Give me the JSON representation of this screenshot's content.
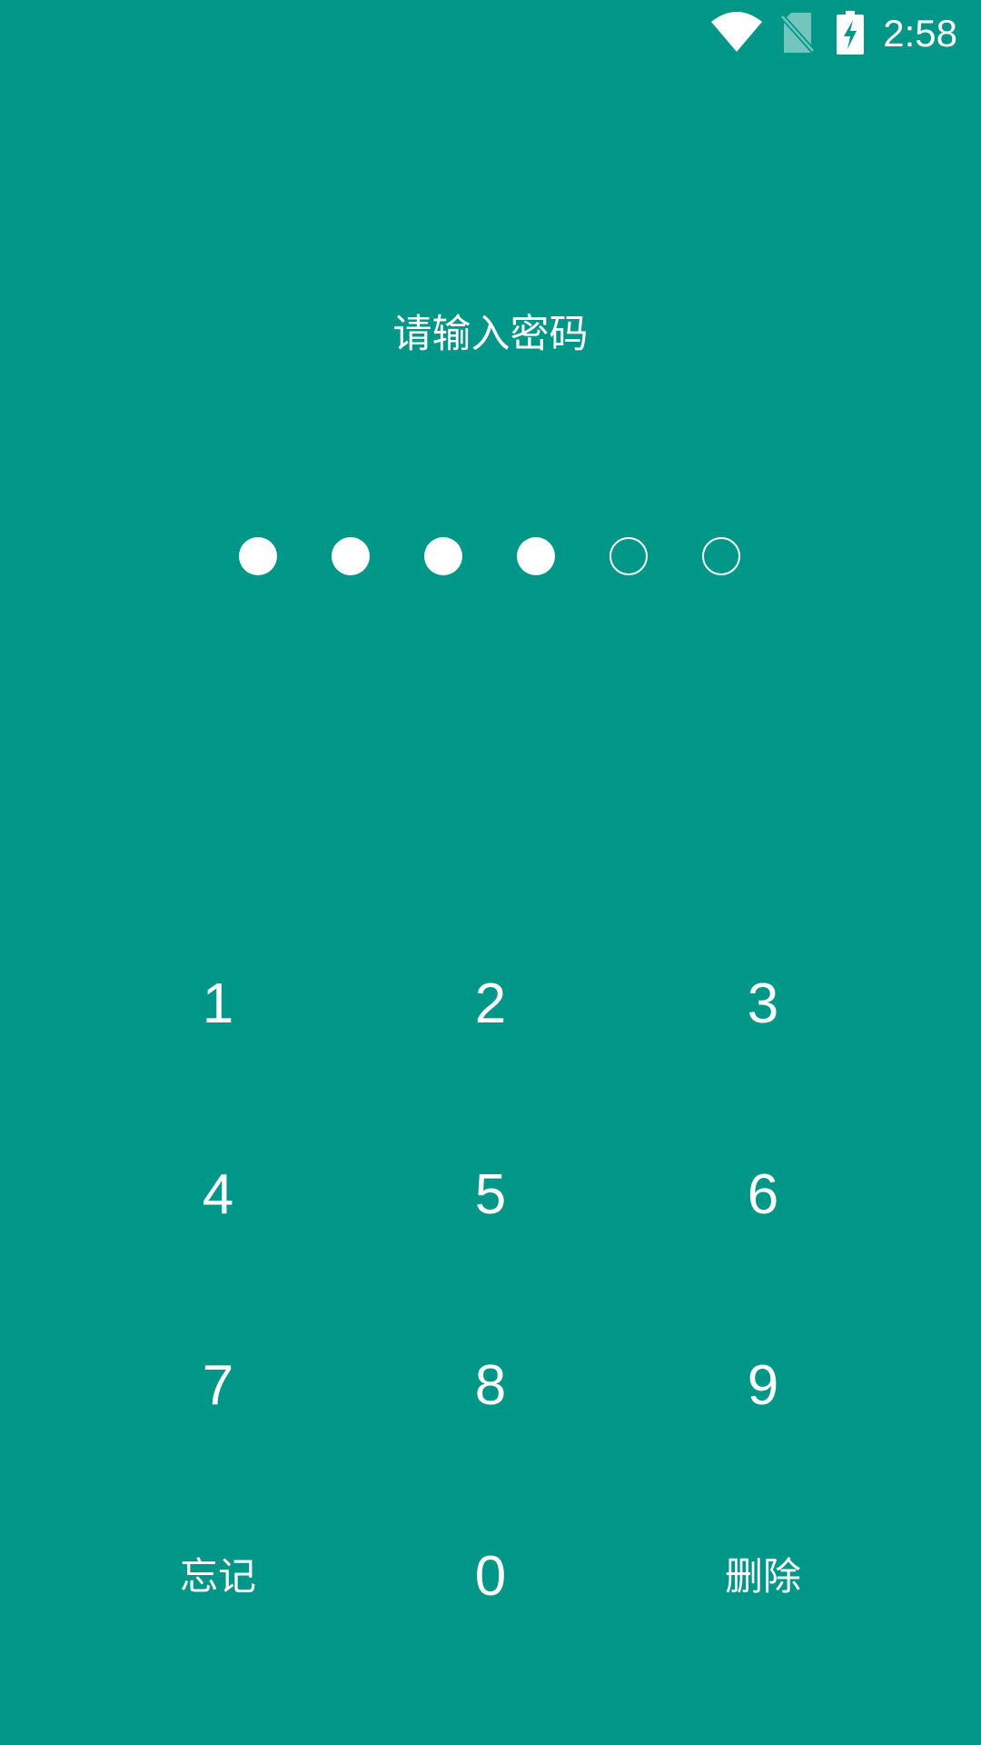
{
  "status_bar": {
    "time": "2:58",
    "icons": [
      "wifi-icon",
      "no-sim-icon",
      "battery-charging-icon"
    ]
  },
  "lock_screen": {
    "title": "请输入密码",
    "pin_length": 6,
    "pin_entered": 4
  },
  "keypad": {
    "keys": [
      "1",
      "2",
      "3",
      "4",
      "5",
      "6",
      "7",
      "8",
      "9"
    ],
    "forgot_label": "忘记",
    "zero_label": "0",
    "delete_label": "删除"
  },
  "colors": {
    "background": "#009688",
    "foreground": "#ffffff"
  }
}
